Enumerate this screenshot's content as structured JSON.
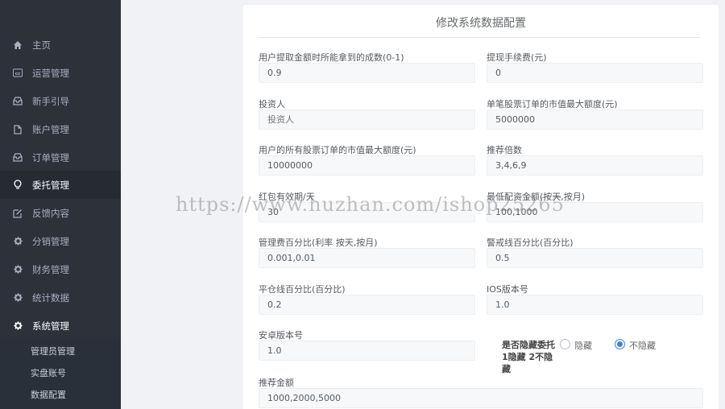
{
  "sidebar": {
    "items": [
      {
        "label": "主页",
        "icon": "home-icon"
      },
      {
        "label": "运营管理",
        "icon": "cc-icon"
      },
      {
        "label": "新手引导",
        "icon": "inbox-icon"
      },
      {
        "label": "账户管理",
        "icon": "file-icon"
      },
      {
        "label": "订单管理",
        "icon": "inbox-icon"
      },
      {
        "label": "委托管理",
        "icon": "lightbulb-icon"
      },
      {
        "label": "反馈内容",
        "icon": "edit-icon"
      },
      {
        "label": "分销管理",
        "icon": "gear-icon"
      },
      {
        "label": "财务管理",
        "icon": "gear-icon"
      },
      {
        "label": "统计数据",
        "icon": "gear-icon"
      },
      {
        "label": "系统管理",
        "icon": "gear-icon"
      }
    ],
    "sub_items": [
      "管理员管理",
      "实盘账号",
      "数据配置"
    ]
  },
  "form": {
    "title": "修改系统数据配置",
    "fields": [
      {
        "label": "用户提取金额时所能拿到的成数(0-1)",
        "value": "0.9"
      },
      {
        "label": "提现手续费(元)",
        "value": "0"
      },
      {
        "label": "投资人",
        "value": "",
        "placeholder": "投资人"
      },
      {
        "label": "单笔股票订单的市值最大额度(元)",
        "value": "5000000"
      },
      {
        "label": "用户的所有股票订单的市值最大额度(元)",
        "value": "10000000"
      },
      {
        "label": "推荐倍数",
        "value": "3,4,6,9"
      },
      {
        "label": "红包有效期/天",
        "value": "30"
      },
      {
        "label": "最低配资金额(按天,按月)",
        "value": "100,1000"
      },
      {
        "label": "管理费百分比(利率 按天,按月)",
        "value": "0.001,0.01"
      },
      {
        "label": "警戒线百分比(百分比)",
        "value": "0.5"
      },
      {
        "label": "平仓线百分比(百分比)",
        "value": "0.2"
      },
      {
        "label": "IOS版本号",
        "value": "1.0"
      },
      {
        "label": "安卓版本号",
        "value": "1.0"
      },
      {
        "label": "推荐金额",
        "value": "1000,2000,5000"
      }
    ],
    "hide_option": {
      "label": "是否隐藏委托 1隐藏 2不隐藏",
      "options": [
        "隐藏",
        "不隐藏"
      ],
      "selected": "不隐藏"
    }
  },
  "watermark": "https://www.huzhan.com/ishop25265"
}
